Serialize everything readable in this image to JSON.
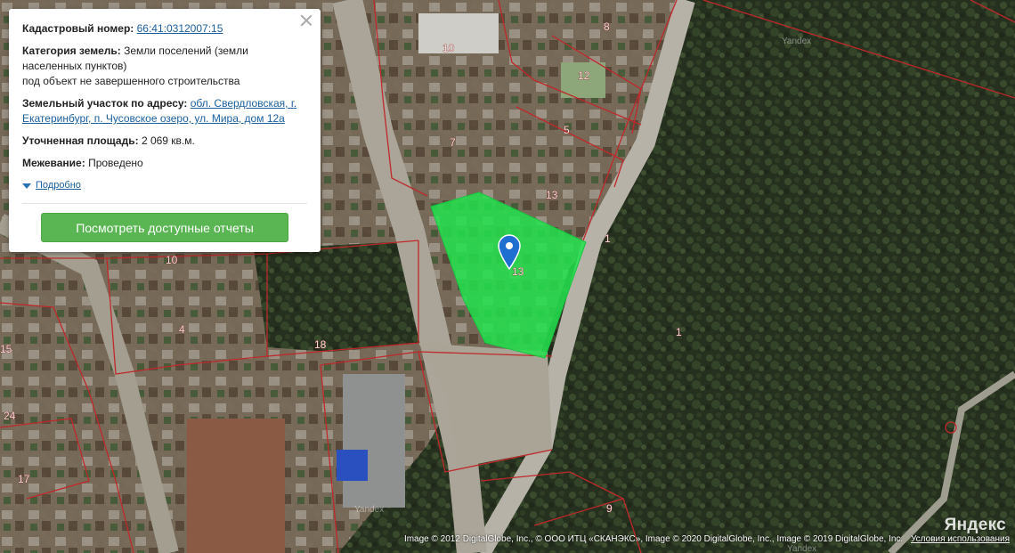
{
  "info_card": {
    "cadastral_label": "Кадастровый номер:",
    "cadastral_number": "66:41:0312007:15",
    "category_label": "Категория земель:",
    "category_value": "Земли поселений (земли населенных пунктов)",
    "category_purpose": "под объект не завершенного строительства",
    "address_label": "Земельный участок по адресу:",
    "address_value": "обл. Свердловская, г. Екатеринбург, п. Чусовское озеро, ул. Мира, дом 12а",
    "area_label": "Уточненная площадь:",
    "area_value": "2 069 кв.м.",
    "survey_label": "Межевание:",
    "survey_value": "Проведено",
    "details_link": "Подробно",
    "reports_button": "Посмотреть доступные отчеты"
  },
  "map": {
    "parcel_numbers": [
      "10",
      "8",
      "12",
      "7",
      "5",
      "13",
      "1",
      "10",
      "4",
      "18",
      "15",
      "24",
      "17",
      "9",
      "1",
      "13"
    ],
    "watermarks": [
      "Yandex",
      "Yandex",
      "Yandex"
    ],
    "selected_parcel_color": "#22e34e",
    "boundary_color": "#c0282a",
    "marker_color": "#1e6fd0"
  },
  "attribution": {
    "text": "Image © 2012 DigitalGlobe, Inc., © ООО ИТЦ «СКАНЭКС», Image © 2020 DigitalGlobe, Inc., Image © 2019 DigitalGlobe, Inc.",
    "terms_link": "Условия использования",
    "logo": "Яндекс"
  }
}
